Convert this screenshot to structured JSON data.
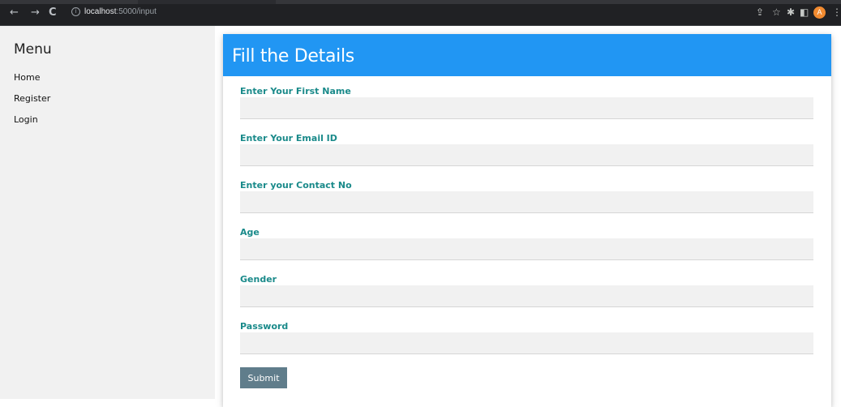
{
  "browser": {
    "url_host": "localhost",
    "url_path": ":5000/input",
    "back_icon": "←",
    "forward_icon": "→",
    "reload_icon": "C",
    "share_icon": "⇪",
    "bookmark_icon": "☆",
    "extensions_icon": "✱",
    "sidepanel_icon": "◧",
    "profile_initial": "A",
    "menu_icon": "⋮"
  },
  "sidebar": {
    "title": "Menu",
    "items": [
      {
        "label": "Home"
      },
      {
        "label": "Register"
      },
      {
        "label": "Login"
      }
    ]
  },
  "form": {
    "title": "Fill the Details",
    "fields": [
      {
        "label": "Enter Your First Name",
        "value": ""
      },
      {
        "label": "Enter Your Email ID",
        "value": ""
      },
      {
        "label": "Enter your Contact No",
        "value": ""
      },
      {
        "label": "Age",
        "value": ""
      },
      {
        "label": "Gender",
        "value": ""
      },
      {
        "label": "Password",
        "value": ""
      }
    ],
    "submit_label": "Submit"
  },
  "colors": {
    "header_blue": "#2196F3",
    "label_teal": "#1a8a8a",
    "submit_gray": "#607d8b",
    "sidebar_bg": "#f1f1f1"
  }
}
